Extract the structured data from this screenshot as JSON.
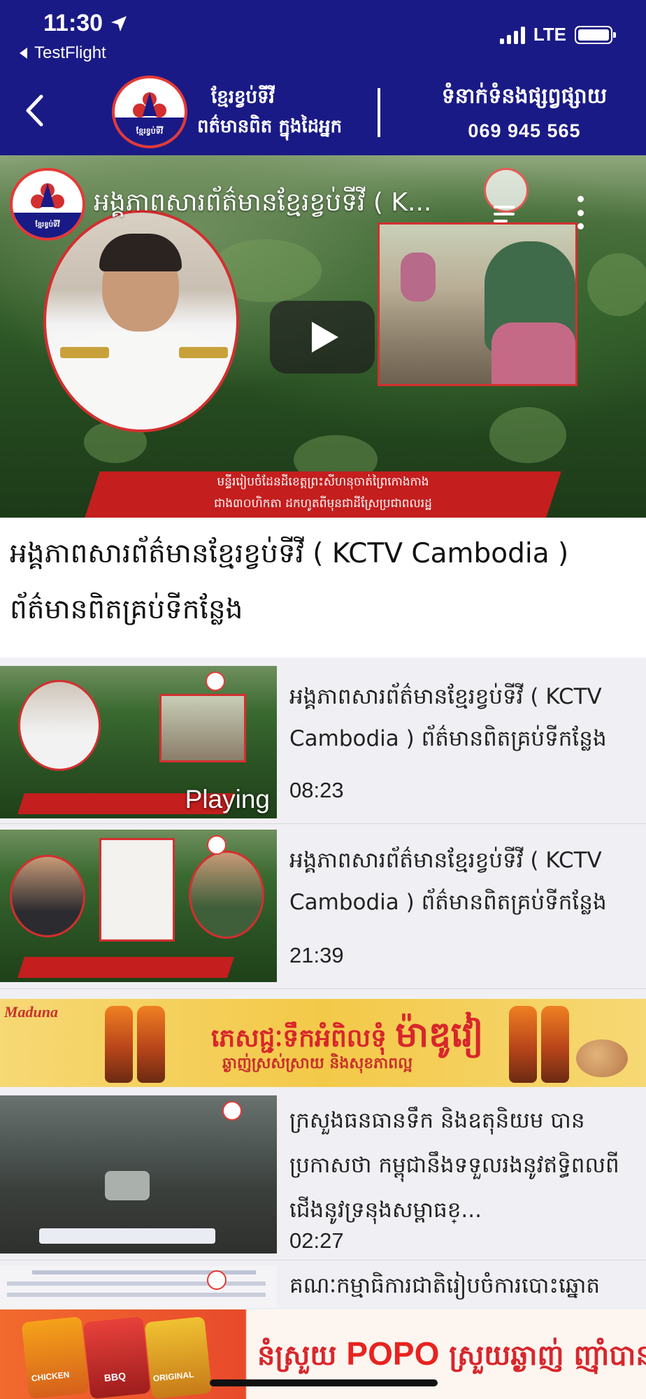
{
  "status_bar": {
    "time": "11:30",
    "back_app": "TestFlight",
    "network": "LTE",
    "location_icon": "location-arrow-icon"
  },
  "header": {
    "logo_text": "ខ្មែរខ្វប់ទីវី",
    "brand_line1": "ខ្មែរខ្វប់ទីវី",
    "brand_line2": "ពត៌មានពិត ក្នុងដៃអ្នក",
    "contact_label": "ទំនាក់ទំនងផ្សព្វផ្សាយ",
    "contact_phone": "069 945 565",
    "accent_color": "#1a1a86",
    "brand_red": "#d32f2f"
  },
  "player": {
    "title": "អង្គភាពសារព័ត៌មានខ្មែរខ្វប់ទីវី ( K...",
    "channel_logo_text": "ខ្មែរខ្វប់ទីវី",
    "banner_line1": "មន្ទីររៀបចំដែនដីខេត្តព្រះសីហនុចាត់ព្រៃកោងកាង",
    "banner_line2": "ជាង៣០ហិកតា ដកហូតពីមុនជាដីស្រែប្រជាពលរដ្ឋ"
  },
  "heading": {
    "line1": "អង្គភាពសារព័ត៌មានខ្មែរខ្វប់ទីវី ( KCTV Cambodia )",
    "line2": "ព័ត៌មានពិតគ្រប់ទីកន្លែង"
  },
  "list": {
    "items": [
      {
        "line1": "អង្គភាពសារព័ត៌មានខ្មែរខ្វប់ទីវី ( KCTV",
        "line2": "Cambodia ) ព័ត៌មានពិតគ្រប់ទីកន្លែង",
        "line3": "",
        "duration": "08:23",
        "badge": "Playing"
      },
      {
        "line1": "អង្គភាពសារព័ត៌មានខ្មែរខ្វប់ទីវី ( KCTV",
        "line2": "Cambodia ) ព័ត៌មានពិតគ្រប់ទីកន្លែង",
        "line3": "",
        "duration": "21:39"
      },
      {
        "line1": "ក្រសួងធនធានទឹក និងឧតុនិយម បាន",
        "line2": "ប្រកាសថា កម្ពុជានឹងទទួលរងនូវឥទ្ធិពលពី",
        "line3": "ជើងនូវទ្រនុងសម្ពាធខ្...",
        "duration": "02:27"
      },
      {
        "line1": "គណៈកម្មាធិការជាតិរៀបចំការបោះឆ្នោត",
        "line2": "",
        "line3": "",
        "duration": ""
      }
    ]
  },
  "ads": {
    "ad1": {
      "brand": "Maduna",
      "line1_a": "ភេសជ្ជៈទឹកអំពិលទុំ",
      "line1_b": "ម៉ាឌូវៀ",
      "line2": "ឆ្ងាញ់ស្រស់ស្រាយ និងសុខភាពល្អ"
    },
    "ad2": {
      "txt_a": "នំស្រួយ",
      "txt_b": "POPO",
      "txt_c": "ស្រួយឆ្ងាញ់ ញ៉ាំបានគ្រប់ពេល",
      "chip1": "CHICKEN",
      "chip2": "BBQ",
      "chip3": "ORIGINAL"
    }
  }
}
